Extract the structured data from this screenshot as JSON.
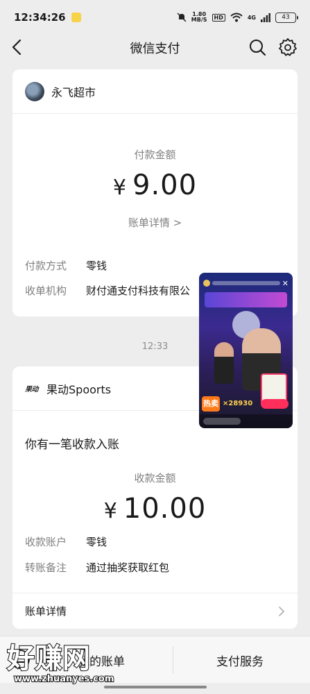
{
  "status_bar": {
    "time": "12:34:26",
    "net_speed_value": "1.80",
    "net_speed_unit": "MB/S",
    "hd": "HD",
    "signal": "4G",
    "battery": "43"
  },
  "nav": {
    "title": "微信支付"
  },
  "payment_card": {
    "merchant": "永飞超市",
    "amount_label": "付款金额",
    "currency": "¥",
    "amount": "9.00",
    "detail_link": "账单详情 >",
    "rows": [
      {
        "key": "付款方式",
        "value": "零钱"
      },
      {
        "key": "收单机构",
        "value": "财付通支付科技有限公"
      }
    ]
  },
  "time_separator": "12:33",
  "receipt_card": {
    "brand_logo": "果动",
    "merchant": "果动Spoorts",
    "notice": "你有一笔收款入账",
    "amount_label": "收款金额",
    "currency": "¥",
    "amount": "10.00",
    "rows": [
      {
        "key": "收款账户",
        "value": "零钱"
      },
      {
        "key": "转账备注",
        "value": "通过抽奖获取红包"
      }
    ],
    "detail_label": "账单详情"
  },
  "floating_video": {
    "hot_label": "热卖",
    "viewer_count": "×28930"
  },
  "bottom_bar": {
    "tabs": [
      "我的账单",
      "支付服务"
    ]
  },
  "watermark": {
    "text": "好赚网",
    "url": "www.zhuanyes.com"
  },
  "colors": {
    "background": "#ededed",
    "card": "#ffffff",
    "secondary_text": "#7f7f7f"
  }
}
